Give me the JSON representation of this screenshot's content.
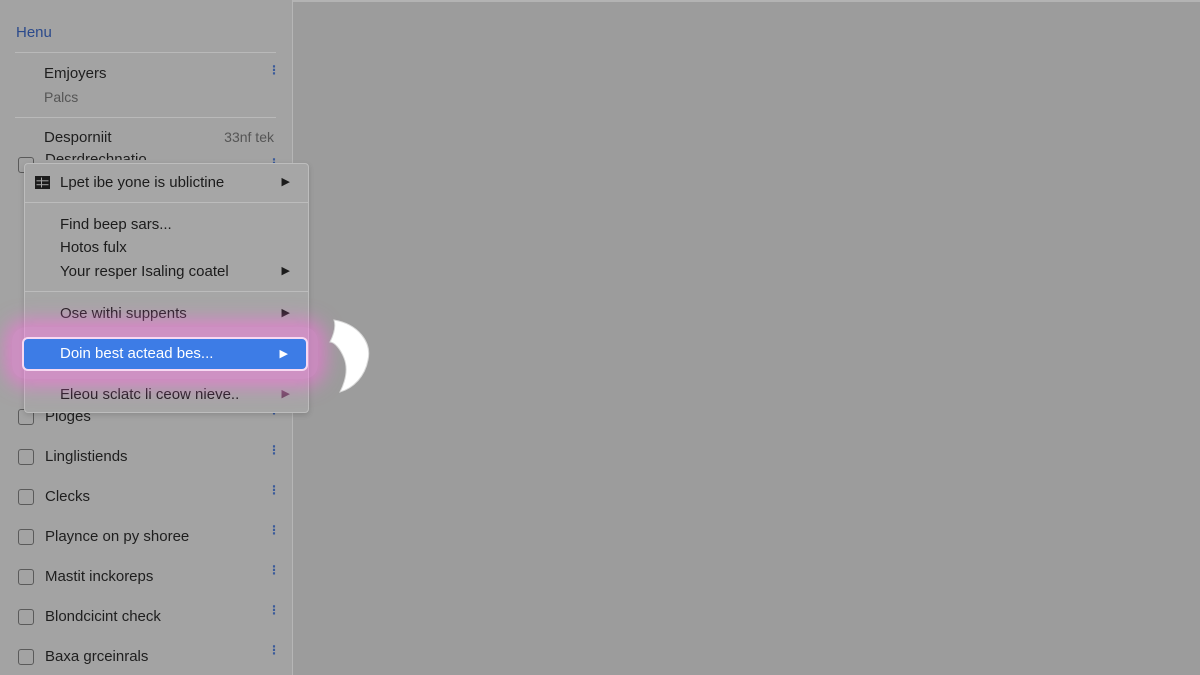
{
  "sidebar": {
    "title": "Henu",
    "section1": {
      "main": "Emjoyers",
      "sub": "Palcs"
    },
    "section2": {
      "main": "Desporniit",
      "meta": "33nf tek",
      "hidden_item": "Desrdrechnatio"
    },
    "items": [
      {
        "label": "Ploges"
      },
      {
        "label": "Linglistiends"
      },
      {
        "label": "Clecks"
      },
      {
        "label": "Playnce on py shoree"
      },
      {
        "label": "Mastit inckoreps"
      },
      {
        "label": "Blondcicint check"
      },
      {
        "label": "Baxa grceinrals"
      }
    ]
  },
  "context_menu": {
    "items": [
      {
        "label": "Lpet ibe yone is ublictine",
        "submenu": true,
        "icon": "table-grid-icon"
      },
      {
        "label": "Find beep sars...",
        "submenu": false
      },
      {
        "label": "Hotos fulx",
        "submenu": false
      },
      {
        "label": "Your resper Isaling coatel",
        "submenu": true
      },
      {
        "label": "Ose withi suppents",
        "submenu": true
      },
      {
        "label": "Doin best actead bes...",
        "submenu": true,
        "highlighted": true
      },
      {
        "label": "Eleou sclatc li ceow nieve..",
        "submenu": true
      }
    ]
  },
  "colors": {
    "highlight": "#3d7ce6",
    "glow": "#ff6ee1",
    "accent_text": "#2b4a8c",
    "background": "#9c9c9c"
  }
}
